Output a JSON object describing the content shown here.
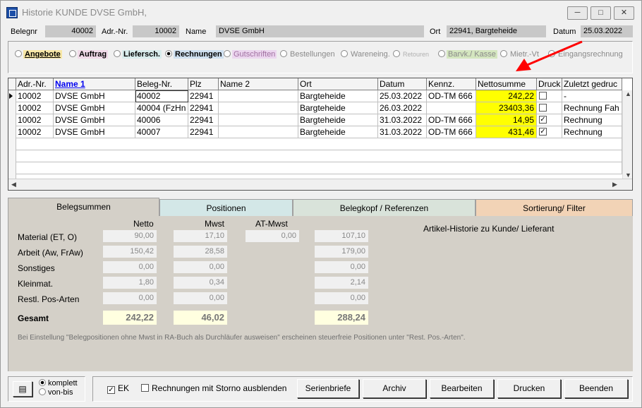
{
  "window": {
    "title": "Historie KUNDE DVSE GmbH,"
  },
  "header": {
    "belegnr_label": "Belegnr",
    "belegnr": "40002",
    "adrnr_label": "Adr.-Nr.",
    "adrnr": "10002",
    "name_label": "Name",
    "name": "DVSE GmbH",
    "ort_label": "Ort",
    "ort": "22941, Bargteheide",
    "datum_label": "Datum",
    "datum": "25.03.2022"
  },
  "filters": [
    {
      "label": "Angebote",
      "selected": false
    },
    {
      "label": "Auftrag",
      "selected": false
    },
    {
      "label": "Liefersch.",
      "selected": false
    },
    {
      "label": "Rechnungen",
      "selected": true
    },
    {
      "label": "Gutschriften",
      "selected": false
    },
    {
      "label": "Bestellungen",
      "selected": false
    },
    {
      "label": "Wareneing.",
      "selected": false
    },
    {
      "label": "Retouren",
      "selected": false
    },
    {
      "label": "Barvk./ Kasse",
      "selected": false
    },
    {
      "label": "Mietr.-Vt",
      "selected": false
    },
    {
      "label": "Eingangsrechnung",
      "selected": false
    }
  ],
  "grid": {
    "columns": [
      "Adr.-Nr.",
      "Name 1",
      "Beleg-Nr.",
      "Plz",
      "Name 2",
      "Ort",
      "Datum",
      "Kennz.",
      "Nettosumme",
      "Druck",
      "Zuletzt gedruc"
    ],
    "rows": [
      {
        "adrnr": "10002",
        "name1": "DVSE GmbH",
        "belegnr": "40002",
        "plz": "22941",
        "name2": "",
        "ort": "Bargteheide",
        "datum": "25.03.2022",
        "kennz": "OD-TM 666",
        "netto": "242,22",
        "druck": false,
        "zuletzt": "-"
      },
      {
        "adrnr": "10002",
        "name1": "DVSE GmbH",
        "belegnr": "40004 (FzHn",
        "plz": "22941",
        "name2": "",
        "ort": "Bargteheide",
        "datum": "26.03.2022",
        "kennz": "",
        "netto": "23403,36",
        "druck": false,
        "zuletzt": "Rechnung Fah"
      },
      {
        "adrnr": "10002",
        "name1": "DVSE GmbH",
        "belegnr": "40006",
        "plz": "22941",
        "name2": "",
        "ort": "Bargteheide",
        "datum": "31.03.2022",
        "kennz": "OD-TM 666",
        "netto": "14,95",
        "druck": true,
        "zuletzt": "Rechnung"
      },
      {
        "adrnr": "10002",
        "name1": "DVSE GmbH",
        "belegnr": "40007",
        "plz": "22941",
        "name2": "",
        "ort": "Bargteheide",
        "datum": "31.03.2022",
        "kennz": "OD-TM 666",
        "netto": "431,46",
        "druck": true,
        "zuletzt": "Rechnung"
      }
    ]
  },
  "tabs": [
    {
      "label": "Belegsummen",
      "color": "#f0f0f0"
    },
    {
      "label": "Positionen",
      "color": "#d3e7e7"
    },
    {
      "label": "Belegkopf / Referenzen",
      "color": "#d9e3da"
    },
    {
      "label": "Sortierung/ Filter",
      "color": "#f2d3b6"
    }
  ],
  "summary": {
    "headers": {
      "netto": "Netto",
      "mwst": "Mwst",
      "at_mwst": "AT-Mwst"
    },
    "rows": [
      {
        "label": "Material (ET, O)",
        "netto": "90,00",
        "mwst": "17,10",
        "at": "0,00",
        "total": "107,10"
      },
      {
        "label": "Arbeit (Aw, FrAw)",
        "netto": "150,42",
        "mwst": "28,58",
        "total": "179,00"
      },
      {
        "label": "Sonstiges",
        "netto": "0,00",
        "mwst": "0,00",
        "total": "0,00"
      },
      {
        "label": "Kleinmat.",
        "netto": "1,80",
        "mwst": "0,34",
        "total": "2,14"
      },
      {
        "label": "Restl. Pos-Arten",
        "netto": "0,00",
        "mwst": "0,00",
        "total": "0,00"
      }
    ],
    "gesamt": {
      "label": "Gesamt",
      "netto": "242,22",
      "mwst": "46,02",
      "total": "288,24"
    },
    "info": "Artikel-Historie zu Kunde/ Lieferant",
    "note": "Bei Einstellung \"Belegpositionen ohne Mwst in RA-Buch als Durchläufer ausweisen\" erscheinen steuerfreie Positionen unter \"Rest. Pos.-Arten\"."
  },
  "bottom": {
    "komplett": "komplett",
    "vonbis": "von-bis",
    "ek_label": "EK",
    "storno_label": "Rechnungen mit Storno ausblenden",
    "buttons": [
      "Serienbriefe",
      "Archiv",
      "Bearbeiten",
      "Drucken",
      "Beenden"
    ]
  },
  "colors": {
    "highlight": "#ffff00",
    "annotation_arrow": "#ff0000"
  }
}
